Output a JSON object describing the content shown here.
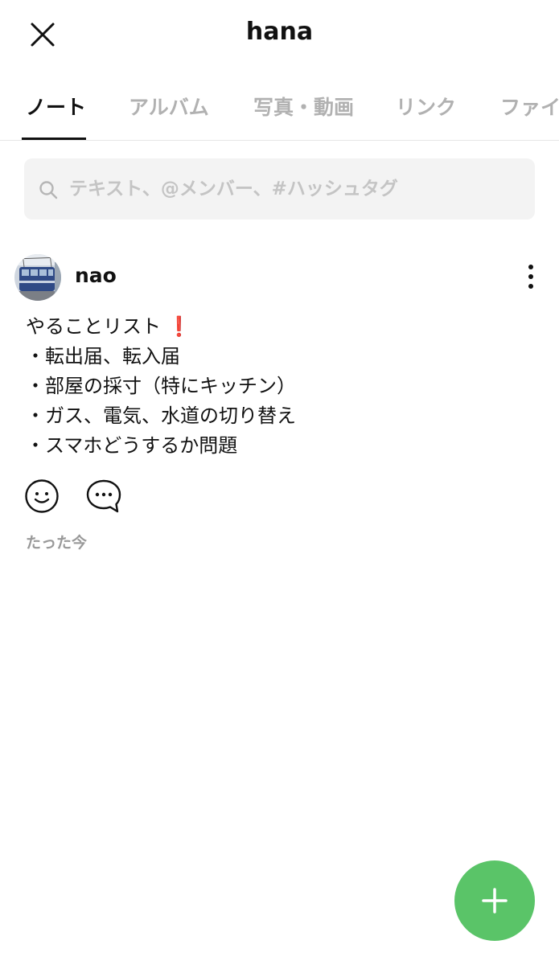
{
  "header": {
    "title": "hana"
  },
  "tabs": [
    {
      "label": "ノート",
      "active": true
    },
    {
      "label": "アルバム",
      "active": false
    },
    {
      "label": "写真・動画",
      "active": false
    },
    {
      "label": "リンク",
      "active": false
    },
    {
      "label": "ファイル",
      "active": false
    }
  ],
  "search": {
    "placeholder": "テキスト、@メンバー、#ハッシュタグ",
    "value": ""
  },
  "post": {
    "author": "nao",
    "title_text": "やることリスト",
    "title_emoji": "❗",
    "lines": [
      "・転出届、転入届",
      "・部屋の採寸（特にキッチン）",
      "・ガス、電気、水道の切り替え",
      "・スマホどうするか問題"
    ],
    "timestamp": "たった今"
  },
  "colors": {
    "fab": "#5ac468",
    "active_tab": "#111111",
    "inactive_tab": "#b1b1b1"
  },
  "icons": {
    "close": "close-icon",
    "search": "search-icon",
    "more": "more-vertical-icon",
    "reaction": "smiley-icon",
    "comment": "comment-bubble-icon",
    "add": "plus-icon"
  }
}
